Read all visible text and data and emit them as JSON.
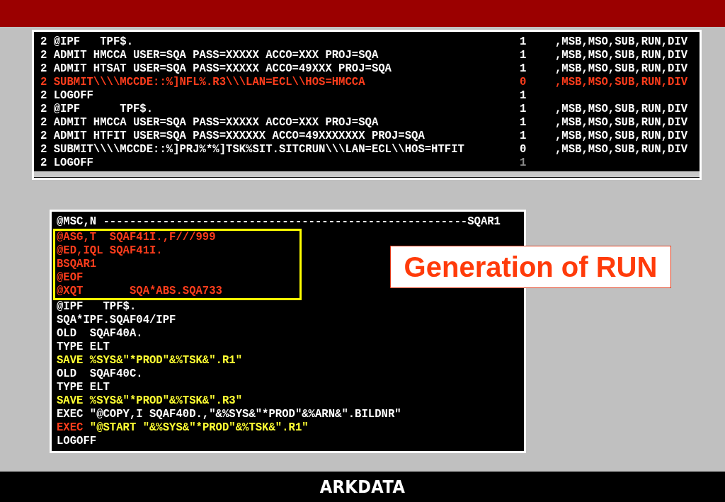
{
  "job_listing": {
    "rows": [
      {
        "cells": [
          {
            "text": "2 @IPF   TPF$.",
            "color": "#ffffff"
          },
          {
            "text": "1",
            "color": "#ffffff"
          },
          {
            "text": ",MSB,MSO,SUB,RUN,DIV",
            "color": "#ffffff"
          }
        ]
      },
      {
        "cells": [
          {
            "text": "2 ADMIT HMCCA USER=SQA PASS=XXXXX ACCO=XXX PROJ=SQA",
            "color": "#ffffff"
          },
          {
            "text": "1",
            "color": "#ffffff"
          },
          {
            "text": ",MSB,MSO,SUB,RUN,DIV",
            "color": "#ffffff"
          }
        ]
      },
      {
        "cells": [
          {
            "text": "2 ADMIT HTSAT USER=SQA PASS=XXXXX ACCO=49XXX PROJ=SQA",
            "color": "#ffffff"
          },
          {
            "text": "1",
            "color": "#ffffff"
          },
          {
            "text": ",MSB,MSO,SUB,RUN,DIV",
            "color": "#ffffff"
          }
        ]
      },
      {
        "cells": [
          {
            "text": "2 SUBMIT\\\\\\\\MCCDE::%]NFL%.R3\\\\\\LAN=ECL\\\\HOS=HMCCA",
            "color": "#ff3d1c"
          },
          {
            "text": "0",
            "color": "#ff3d1c"
          },
          {
            "text": ",MSB,MSO,SUB,RUN,DIV",
            "color": "#ff3d1c"
          }
        ]
      },
      {
        "cells": [
          {
            "text": "2 LOGOFF",
            "color": "#ffffff"
          },
          {
            "text": "1",
            "color": "#ffffff"
          }
        ]
      },
      {
        "cells": [
          {
            "text": "2 @IPF      TPF$.",
            "color": "#ffffff"
          },
          {
            "text": "1",
            "color": "#ffffff"
          },
          {
            "text": ",MSB,MSO,SUB,RUN,DIV",
            "color": "#ffffff"
          }
        ]
      },
      {
        "cells": [
          {
            "text": "2 ADMIT HMCCA USER=SQA PASS=XXXXX ACCO=XXX PROJ=SQA",
            "color": "#ffffff"
          },
          {
            "text": "1",
            "color": "#ffffff"
          },
          {
            "text": ",MSB,MSO,SUB,RUN,DIV",
            "color": "#ffffff"
          }
        ]
      },
      {
        "cells": [
          {
            "text": "2 ADMIT HTFIT USER=SQA PASS=XXXXXX ACCO=49XXXXXXX PROJ=SQA",
            "color": "#ffffff"
          },
          {
            "text": "1",
            "color": "#ffffff"
          },
          {
            "text": ",MSB,MSO,SUB,RUN,DIV",
            "color": "#ffffff"
          }
        ]
      },
      {
        "cells": [
          {
            "text": "2 SUBMIT\\\\\\\\MCCDE::%]PRJ%*%]TSK%SIT.SITCRUN\\\\\\LAN=ECL\\\\HOS=HTFIT",
            "color": "#ffffff"
          },
          {
            "text": "0",
            "color": "#ffffff"
          },
          {
            "text": ",MSB,MSO,SUB,RUN,DIV",
            "color": "#ffffff"
          }
        ]
      },
      {
        "cells": [
          {
            "text": "2 LOGOFF",
            "color": "#ffffff"
          },
          {
            "text": "1",
            "color": "#8a8a8a"
          }
        ]
      }
    ]
  },
  "run_listing": {
    "lines": [
      {
        "highlighted": false,
        "segments": [
          {
            "text": "@MSC,N -------------------------------------------------------SQAR1",
            "color": "#ffffff"
          }
        ]
      },
      {
        "highlighted": true,
        "segments": [
          {
            "text": "@ASG,T  SQAF41I.,F///999",
            "color": "#ff3d1c"
          }
        ]
      },
      {
        "highlighted": true,
        "segments": [
          {
            "text": "@ED,IQL SQAF41I.",
            "color": "#ff3d1c"
          }
        ]
      },
      {
        "highlighted": true,
        "segments": [
          {
            "text": "BSQAR1",
            "color": "#ff3d1c"
          }
        ]
      },
      {
        "highlighted": true,
        "segments": [
          {
            "text": "@EOF",
            "color": "#ff3d1c"
          }
        ]
      },
      {
        "highlighted": true,
        "segments": [
          {
            "text": "@XQT       SQA*ABS.SQA733",
            "color": "#ff3d1c"
          }
        ]
      },
      {
        "highlighted": false,
        "segments": [
          {
            "text": "@IPF   TPF$.",
            "color": "#ffffff"
          }
        ]
      },
      {
        "highlighted": false,
        "segments": [
          {
            "text": "SQA*IPF.SQAF04/IPF",
            "color": "#ffffff"
          }
        ]
      },
      {
        "highlighted": false,
        "segments": [
          {
            "text": "OLD  SQAF40A.",
            "color": "#ffffff"
          }
        ]
      },
      {
        "highlighted": false,
        "segments": [
          {
            "text": "TYPE ELT",
            "color": "#ffffff"
          }
        ]
      },
      {
        "highlighted": false,
        "segments": [
          {
            "text": "SAVE %SYS&\"*PROD\"&%TSK&\".R1\"",
            "color": "#ffff33"
          }
        ]
      },
      {
        "highlighted": false,
        "segments": [
          {
            "text": "OLD  SQAF40C.",
            "color": "#ffffff"
          }
        ]
      },
      {
        "highlighted": false,
        "segments": [
          {
            "text": "TYPE ELT",
            "color": "#ffffff"
          }
        ]
      },
      {
        "highlighted": false,
        "segments": [
          {
            "text": "SAVE %SYS&\"*PROD\"&%TSK&\".R3\"",
            "color": "#ffff33"
          }
        ]
      },
      {
        "highlighted": false,
        "segments": [
          {
            "text": "EXEC \"@COPY,I SQAF40D.,\"&%SYS&\"*PROD\"&%ARN&\".BILDNR\"",
            "color": "#ffffff"
          }
        ]
      },
      {
        "highlighted": false,
        "segments": [
          {
            "text": "EXEC",
            "color": "#ff3d1c"
          },
          {
            "text": " \"@START \"&%SYS&\"*PROD\"&%TSK&\".R1\"",
            "color": "#ffff33"
          }
        ]
      },
      {
        "highlighted": false,
        "segments": [
          {
            "text": "LOGOFF",
            "color": "#ffffff"
          }
        ]
      }
    ]
  },
  "callout": {
    "text": "Generation of RUN"
  },
  "footer": {
    "logo": "ARKDATA"
  }
}
